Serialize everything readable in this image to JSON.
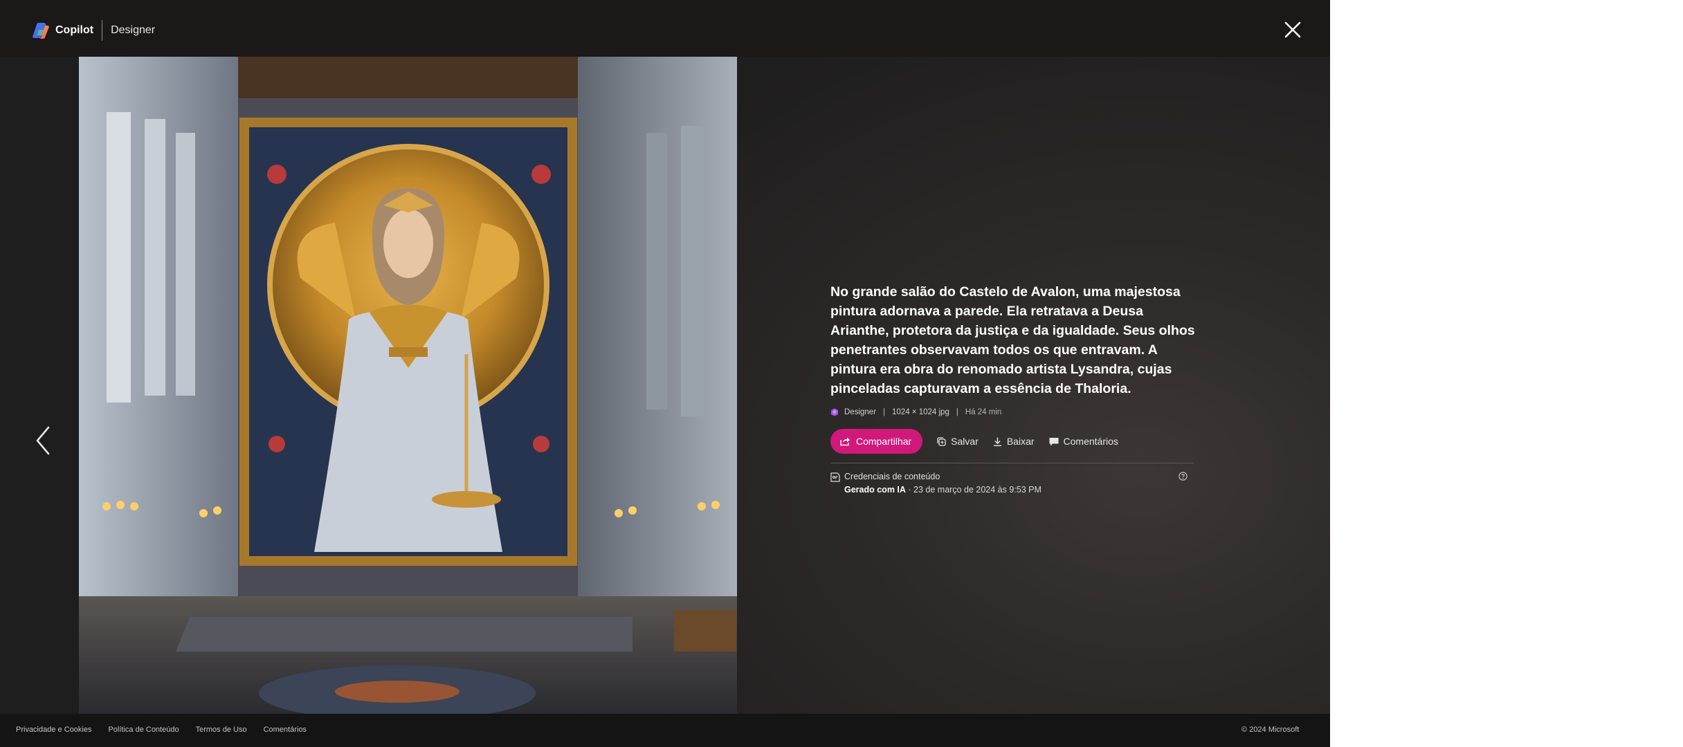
{
  "header": {
    "brand_name": "Copilot",
    "product_name": "Designer",
    "logo_icon": "copilot-logo-icon",
    "close_icon": "close-icon"
  },
  "viewer": {
    "prev_icon": "chevron-left-icon",
    "image_alt": "Pintura da Deusa Arianthe no grande salão do Castelo de Avalon"
  },
  "details": {
    "caption": "No grande salão do Castelo de Avalon, uma majestosa pintura adornava a parede. Ela retratava a Deusa Arianthe, protetora da justiça e da igualdade. Seus olhos penetrantes observavam todos os que entravam. A pintura era obra do renomado artista Lysandra, cujas pinceladas capturavam a essência de Thaloria.",
    "meta": {
      "source": "Designer",
      "separator": "|",
      "dimensions": "1024 × 1024 jpg",
      "time": "Há 24 min"
    },
    "actions": {
      "share": "Compartilhar",
      "save": "Salvar",
      "download": "Baixar",
      "comments": "Comentários"
    },
    "credentials": {
      "title": "Credenciais de conteúdo",
      "generated": "Gerado com IA",
      "date": " · 23 de março de 2024 às 9:53 PM"
    }
  },
  "footer": {
    "links": [
      "Privacidade e Cookies",
      "Política de Conteúdo",
      "Termos de Uso",
      "Comentários"
    ],
    "copyright": "© 2024 Microsoft"
  },
  "colors": {
    "accent": "#d1197a",
    "background": "#1c1b1b",
    "footer": "#141414"
  }
}
